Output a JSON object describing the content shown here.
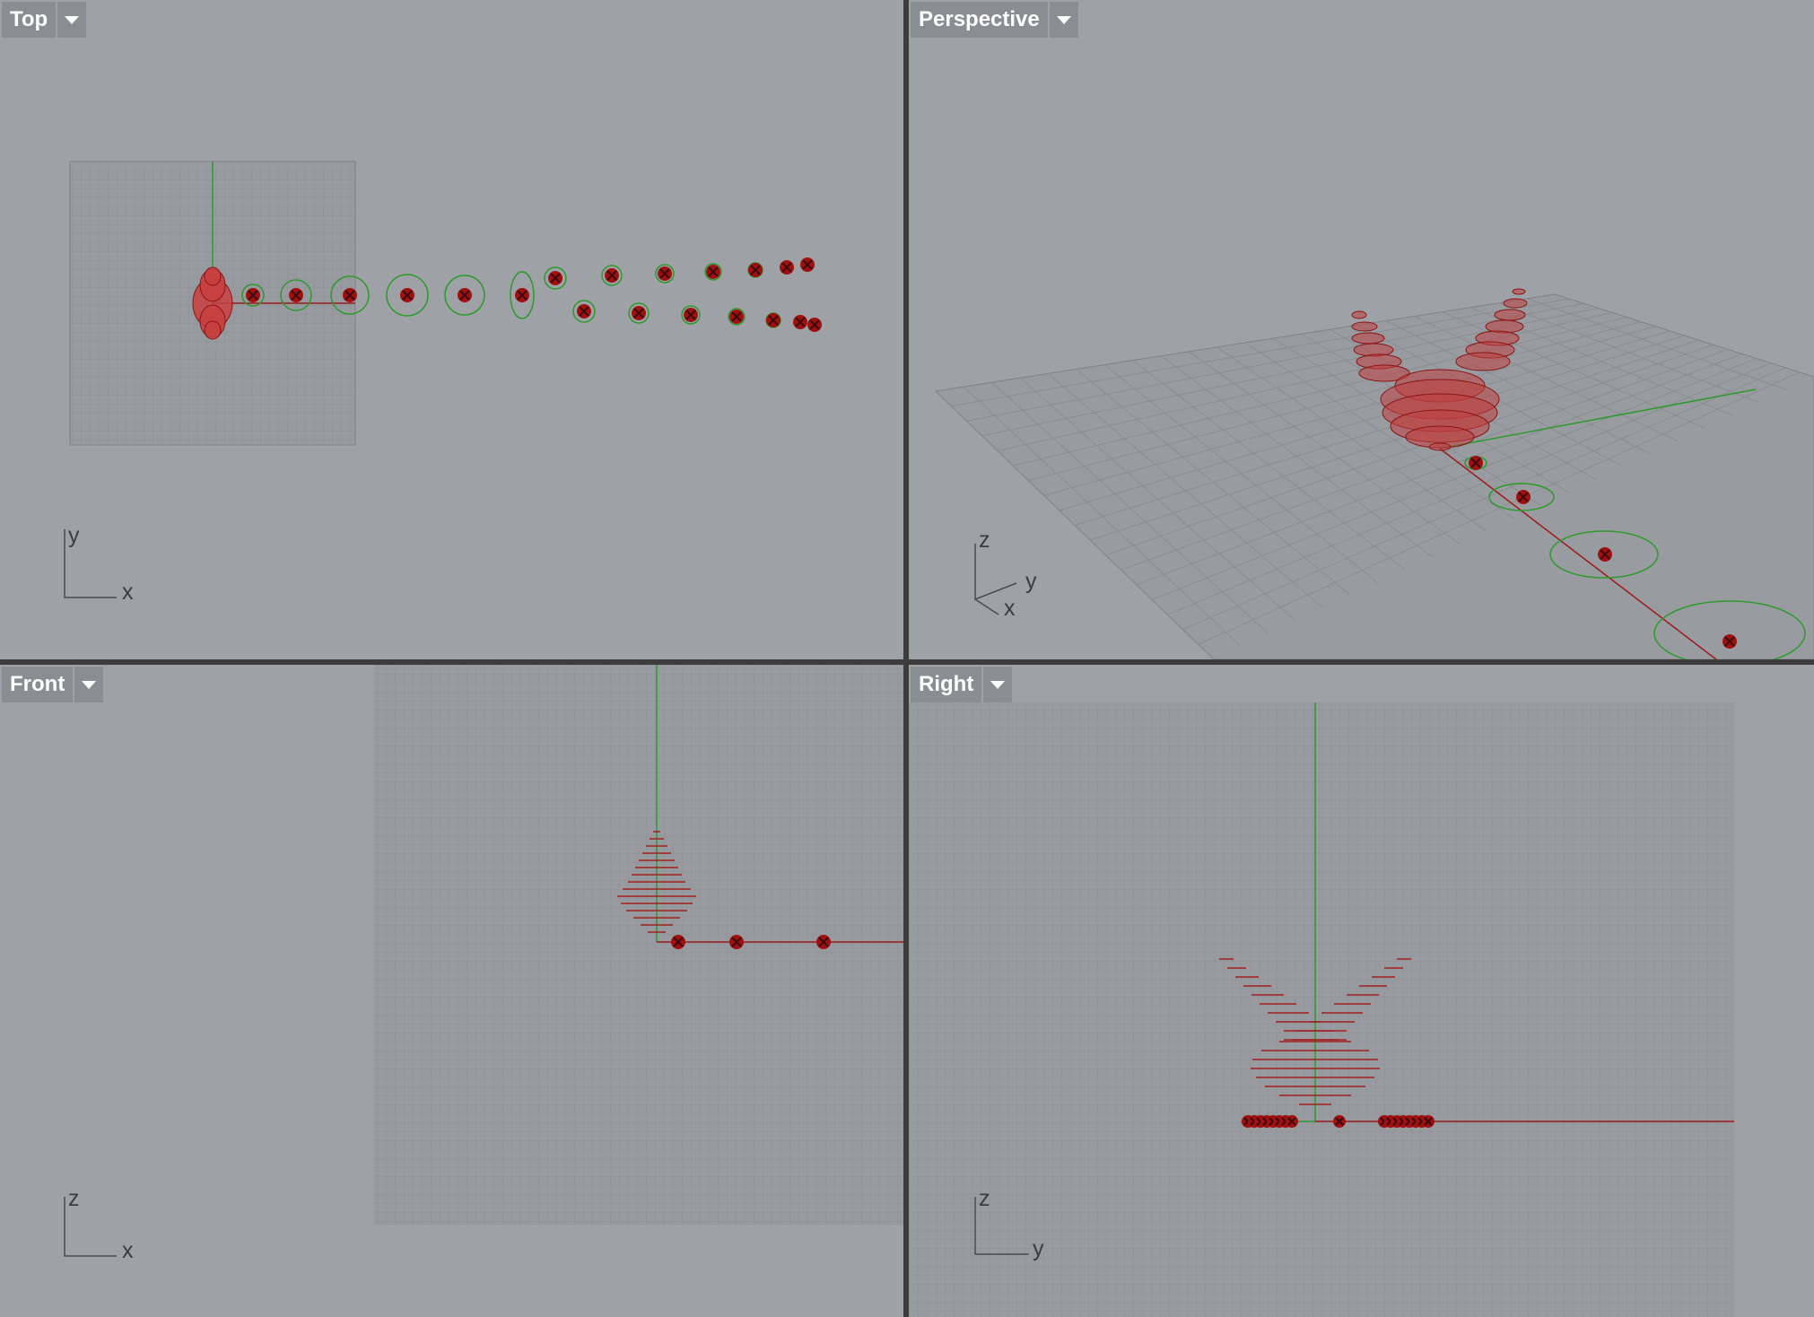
{
  "viewports": {
    "top": {
      "name": "Top",
      "axes": [
        "y",
        "x"
      ]
    },
    "perspective": {
      "name": "Perspective",
      "axes": [
        "z",
        "y",
        "x"
      ]
    },
    "front": {
      "name": "Front",
      "axes": [
        "z",
        "x"
      ]
    },
    "right": {
      "name": "Right",
      "axes": [
        "z",
        "y"
      ]
    }
  },
  "icons": {
    "dropdown": "chevron-down-icon",
    "marker": "x-marker-icon"
  },
  "colors": {
    "viewport_bg": "#9ea1a5",
    "grid_bg": "#979a9e",
    "grid_line": "#8d9094",
    "grid_major": "#7f8286",
    "label_bg": "#8a8d91",
    "x_axis": "#9b1b1b",
    "y_axis": "#2e9a2e",
    "shape_red": "#c03030",
    "marker": "#a01010",
    "divider": "#3c3c3c"
  }
}
